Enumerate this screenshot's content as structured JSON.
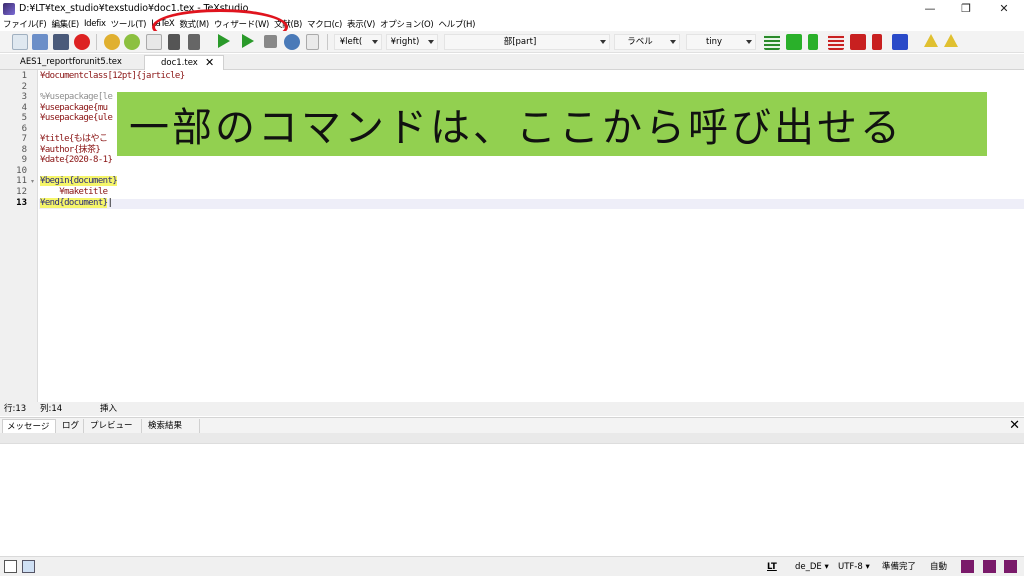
{
  "window": {
    "title": "D:¥LT¥tex_studio¥texstudio¥doc1.tex - TeXstudio",
    "controls": {
      "minimize": "—",
      "restore": "❐",
      "close": "✕"
    }
  },
  "menu": [
    "ファイル(F)",
    "編集(E)",
    "Idefix",
    "ツール(T)",
    "LaTeX",
    "数式(M)",
    "ウィザード(W)",
    "文献(B)",
    "マクロ(c)",
    "表示(V)",
    "オプション(O)",
    "ヘルプ(H)"
  ],
  "toolbar": {
    "left_delim": "¥left(",
    "right_delim": "¥right)",
    "sectioning": "部[part]",
    "label": "ラベル",
    "size": "tiny"
  },
  "tabs": [
    {
      "label": "AES1_reportforunit5.tex",
      "active": false
    },
    {
      "label": "doc1.tex",
      "active": true
    }
  ],
  "editor": {
    "line_numbers": [
      "1",
      "2",
      "3",
      "4",
      "5",
      "6",
      "7",
      "8",
      "9",
      "10",
      "11",
      "12",
      "13"
    ],
    "current_line": 13,
    "lines": [
      {
        "parts": [
          {
            "t": "¥documentclass",
            "c": "kw"
          },
          {
            "t": "[12pt]{jarticle}",
            "c": "kw"
          }
        ]
      },
      {
        "parts": []
      },
      {
        "parts": [
          {
            "t": "%¥usepackage[le",
            "c": "cm"
          }
        ]
      },
      {
        "parts": [
          {
            "t": "¥usepackage",
            "c": "kw"
          },
          {
            "t": "{mu",
            "c": "kw"
          }
        ]
      },
      {
        "parts": [
          {
            "t": "¥usepackage",
            "c": "kw"
          },
          {
            "t": "{ule",
            "c": "kw"
          }
        ]
      },
      {
        "parts": []
      },
      {
        "parts": [
          {
            "t": "¥title",
            "c": "kw"
          },
          {
            "t": "{もはやこ",
            "c": "kw"
          }
        ]
      },
      {
        "parts": [
          {
            "t": "¥author",
            "c": "kw"
          },
          {
            "t": "{抹茶}",
            "c": "kw"
          }
        ]
      },
      {
        "parts": [
          {
            "t": "¥date",
            "c": "kw"
          },
          {
            "t": "{2020-8-1}",
            "c": "kw"
          }
        ]
      },
      {
        "parts": []
      },
      {
        "parts": [
          {
            "t": "¥begin{document}",
            "c": "env"
          }
        ]
      },
      {
        "parts": [
          {
            "t": "    ¥maketitle",
            "c": "kw"
          }
        ]
      },
      {
        "parts": [
          {
            "t": "¥end{document}",
            "c": "env"
          },
          {
            "t": "|",
            "c": ""
          }
        ]
      }
    ]
  },
  "caption": "一部のコマンドは、ここから呼び出せる",
  "status": {
    "row": "行:13",
    "col": "列:14",
    "mode": "挿入"
  },
  "message_tabs": [
    "メッセージ",
    "ログ",
    "プレビュー",
    "検索結果"
  ],
  "bottom": {
    "lt": "LT",
    "lang": "de_DE",
    "encoding": "UTF-8",
    "state": "準備完了",
    "auto": "自動"
  },
  "colors": {
    "caption_bg": "#92d050",
    "annotation": "#e0141e",
    "env_highlight": "#f5f56a"
  }
}
